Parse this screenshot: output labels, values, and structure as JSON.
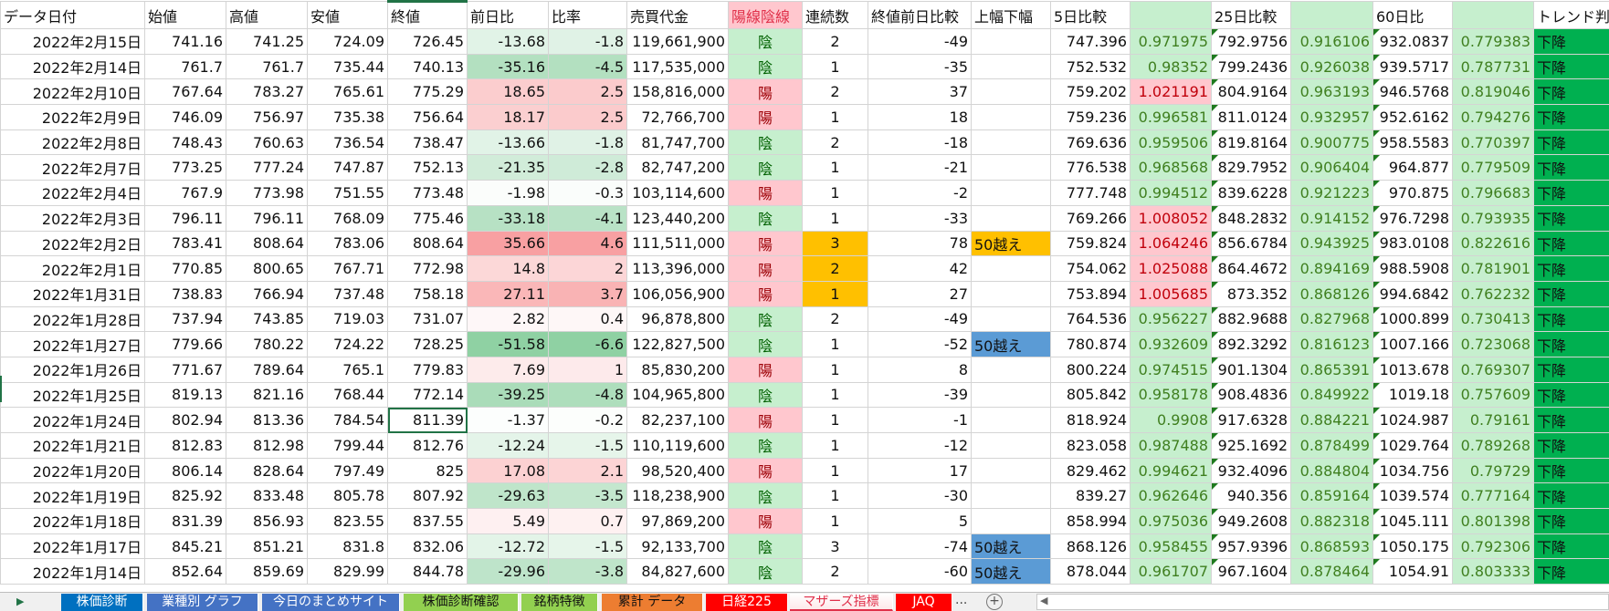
{
  "headers": [
    "データ日付",
    "始値",
    "高値",
    "安値",
    "終値",
    "前日比",
    "比率",
    "売買代金",
    "陽線陰線",
    "連続数",
    "終値前日比較",
    "上幅下幅",
    "5日比較",
    "",
    "25日比較",
    "",
    "60日比",
    "",
    "トレンド判定"
  ],
  "rows": [
    [
      "2022年2月15日",
      "741.16",
      "741.25",
      "724.09",
      "726.45",
      "-13.68",
      "-1.8",
      "119,661,900",
      "陰",
      "2",
      "-49",
      "",
      "747.396",
      "0.971975",
      "792.9756",
      "0.916106",
      "932.0837",
      "0.779383",
      "下降"
    ],
    [
      "2022年2月14日",
      "761.7",
      "761.7",
      "735.44",
      "740.13",
      "-35.16",
      "-4.5",
      "117,535,000",
      "陰",
      "1",
      "-35",
      "",
      "752.532",
      "0.98352",
      "799.2436",
      "0.926038",
      "939.5717",
      "0.787731",
      "下降"
    ],
    [
      "2022年2月10日",
      "767.64",
      "783.27",
      "765.61",
      "775.29",
      "18.65",
      "2.5",
      "158,816,000",
      "陽",
      "2",
      "37",
      "",
      "759.202",
      "1.021191",
      "804.9164",
      "0.963193",
      "946.5768",
      "0.819046",
      "下降"
    ],
    [
      "2022年2月9日",
      "746.09",
      "756.97",
      "735.38",
      "756.64",
      "18.17",
      "2.5",
      "72,766,700",
      "陽",
      "1",
      "18",
      "",
      "759.236",
      "0.996581",
      "811.0124",
      "0.932957",
      "952.6162",
      "0.794276",
      "下降"
    ],
    [
      "2022年2月8日",
      "748.43",
      "760.63",
      "736.54",
      "738.47",
      "-13.66",
      "-1.8",
      "81,747,700",
      "陰",
      "2",
      "-18",
      "",
      "769.636",
      "0.959506",
      "819.8164",
      "0.900775",
      "958.5583",
      "0.770397",
      "下降"
    ],
    [
      "2022年2月7日",
      "773.25",
      "777.24",
      "747.87",
      "752.13",
      "-21.35",
      "-2.8",
      "82,747,200",
      "陰",
      "1",
      "-21",
      "",
      "776.538",
      "0.968568",
      "829.7952",
      "0.906404",
      "964.877",
      "0.779509",
      "下降"
    ],
    [
      "2022年2月4日",
      "767.9",
      "773.98",
      "751.55",
      "773.48",
      "-1.98",
      "-0.3",
      "103,114,600",
      "陽",
      "1",
      "-2",
      "",
      "777.748",
      "0.994512",
      "839.6228",
      "0.921223",
      "970.875",
      "0.796683",
      "下降"
    ],
    [
      "2022年2月3日",
      "796.11",
      "796.11",
      "768.09",
      "775.46",
      "-33.18",
      "-4.1",
      "123,440,200",
      "陰",
      "1",
      "-33",
      "",
      "769.266",
      "1.008052",
      "848.2832",
      "0.914152",
      "976.7298",
      "0.793935",
      "下降"
    ],
    [
      "2022年2月2日",
      "783.41",
      "808.64",
      "783.06",
      "808.64",
      "35.66",
      "4.6",
      "111,511,000",
      "陽",
      "3",
      "78",
      "50越え",
      "759.824",
      "1.064246",
      "856.6784",
      "0.943925",
      "983.0108",
      "0.822616",
      "下降"
    ],
    [
      "2022年2月1日",
      "770.85",
      "800.65",
      "767.71",
      "772.98",
      "14.8",
      "2",
      "113,396,000",
      "陽",
      "2",
      "42",
      "",
      "754.062",
      "1.025088",
      "864.4672",
      "0.894169",
      "988.5908",
      "0.781901",
      "下降"
    ],
    [
      "2022年1月31日",
      "738.83",
      "766.94",
      "737.48",
      "758.18",
      "27.11",
      "3.7",
      "106,056,900",
      "陽",
      "1",
      "27",
      "",
      "753.894",
      "1.005685",
      "873.352",
      "0.868126",
      "994.6842",
      "0.762232",
      "下降"
    ],
    [
      "2022年1月28日",
      "737.94",
      "743.85",
      "719.03",
      "731.07",
      "2.82",
      "0.4",
      "96,878,800",
      "陰",
      "2",
      "-49",
      "",
      "764.536",
      "0.956227",
      "882.9688",
      "0.827968",
      "1000.899",
      "0.730413",
      "下降"
    ],
    [
      "2022年1月27日",
      "779.66",
      "780.22",
      "724.22",
      "728.25",
      "-51.58",
      "-6.6",
      "122,827,500",
      "陰",
      "1",
      "-52",
      "50越え",
      "780.874",
      "0.932609",
      "892.3292",
      "0.816123",
      "1007.166",
      "0.723068",
      "下降"
    ],
    [
      "2022年1月26日",
      "771.67",
      "789.64",
      "765.1",
      "779.83",
      "7.69",
      "1",
      "85,830,200",
      "陽",
      "1",
      "8",
      "",
      "800.224",
      "0.974515",
      "901.1304",
      "0.865391",
      "1013.678",
      "0.769307",
      "下降"
    ],
    [
      "2022年1月25日",
      "819.13",
      "821.16",
      "768.44",
      "772.14",
      "-39.25",
      "-4.8",
      "104,965,800",
      "陰",
      "1",
      "-39",
      "",
      "805.842",
      "0.958178",
      "908.4836",
      "0.849922",
      "1019.18",
      "0.757609",
      "下降"
    ],
    [
      "2022年1月24日",
      "802.94",
      "813.36",
      "784.54",
      "811.39",
      "-1.37",
      "-0.2",
      "82,237,100",
      "陽",
      "1",
      "-1",
      "",
      "818.924",
      "0.9908",
      "917.6328",
      "0.884221",
      "1024.987",
      "0.79161",
      "下降"
    ],
    [
      "2022年1月21日",
      "812.83",
      "812.98",
      "799.44",
      "812.76",
      "-12.24",
      "-1.5",
      "110,119,600",
      "陰",
      "1",
      "-12",
      "",
      "823.058",
      "0.987488",
      "925.1692",
      "0.878499",
      "1029.764",
      "0.789268",
      "下降"
    ],
    [
      "2022年1月20日",
      "806.14",
      "828.64",
      "797.49",
      "825",
      "17.08",
      "2.1",
      "98,520,400",
      "陽",
      "1",
      "17",
      "",
      "829.462",
      "0.994621",
      "932.4096",
      "0.884804",
      "1034.756",
      "0.79729",
      "下降"
    ],
    [
      "2022年1月19日",
      "825.92",
      "833.48",
      "805.78",
      "807.92",
      "-29.63",
      "-3.5",
      "118,238,900",
      "陰",
      "1",
      "-30",
      "",
      "839.27",
      "0.962646",
      "940.356",
      "0.859164",
      "1039.574",
      "0.777164",
      "下降"
    ],
    [
      "2022年1月18日",
      "831.39",
      "856.93",
      "823.55",
      "837.55",
      "5.49",
      "0.7",
      "97,869,200",
      "陽",
      "1",
      "5",
      "",
      "858.994",
      "0.975036",
      "949.2608",
      "0.882318",
      "1045.111",
      "0.801398",
      "下降"
    ],
    [
      "2022年1月17日",
      "845.21",
      "851.21",
      "831.8",
      "832.06",
      "-12.72",
      "-1.5",
      "92,133,700",
      "陰",
      "3",
      "-74",
      "50越え",
      "868.126",
      "0.958455",
      "957.9396",
      "0.868593",
      "1050.175",
      "0.792306",
      "下降"
    ],
    [
      "2022年1月14日",
      "852.64",
      "859.69",
      "829.99",
      "844.78",
      "-29.96",
      "-3.8",
      "84,827,600",
      "陰",
      "2",
      "-60",
      "50越え",
      "878.044",
      "0.961707",
      "967.1604",
      "0.878464",
      "1054.91",
      "0.803333",
      "下降"
    ]
  ],
  "highlight_colors": {
    "orange": "#ffc000",
    "blue": "#5b9bd5"
  },
  "orange_cells": [
    [
      8,
      9
    ],
    [
      9,
      9
    ],
    [
      10,
      9
    ],
    [
      8,
      11
    ]
  ],
  "blue_cells": [
    [
      12,
      11
    ],
    [
      20,
      11
    ],
    [
      21,
      11
    ]
  ],
  "selected_cell": {
    "row": 15,
    "col": 4
  },
  "tabs": [
    {
      "label": "株価診断",
      "bg": "#0070c0",
      "fg": "#ffffff"
    },
    {
      "label": "業種別 グラフ",
      "bg": "#4472c4",
      "fg": "#ffffff"
    },
    {
      "label": "今日のまとめサイト",
      "bg": "#4472c4",
      "fg": "#ffffff"
    },
    {
      "label": "株価診断確認",
      "bg": "#92d050",
      "fg": "#111111"
    },
    {
      "label": "銘柄特徴",
      "bg": "#92d050",
      "fg": "#111111"
    },
    {
      "label": "累計 データ",
      "bg": "#ed7d31",
      "fg": "#111111"
    },
    {
      "label": "日経225",
      "bg": "#ff0000",
      "fg": "#ffffff"
    },
    {
      "label": "マザーズ指標",
      "bg": "#fde9ea",
      "fg": "#e0304a",
      "active": true
    },
    {
      "label": "JAQ",
      "bg": "#ff0000",
      "fg": "#ffffff"
    }
  ],
  "tab_more": "...",
  "tab_add": "+"
}
